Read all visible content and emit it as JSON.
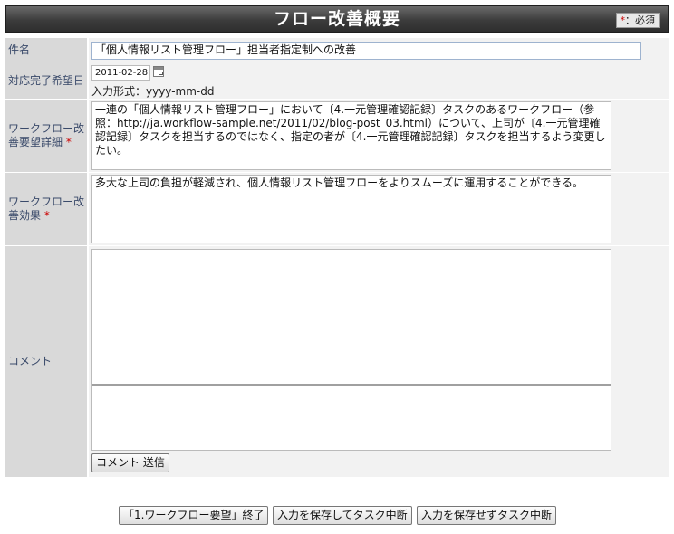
{
  "header": {
    "title": "フロー改善概要",
    "required_legend_mark": "*",
    "required_legend_text": "：必須"
  },
  "fields": {
    "subject": {
      "label": "件名",
      "value": "「個人情報リスト管理フロー」担当者指定制への改善"
    },
    "due_date": {
      "label": "対応完了希望日",
      "value": "2011-02-28",
      "hint": "入力形式：yyyy-mm-dd",
      "icon": "calendar-icon"
    },
    "detail": {
      "label": "ワークフロー改善要望詳細",
      "required_mark": "*",
      "value": "一連の「個人情報リスト管理フロー」において〔4.一元管理確認記録〕タスクのあるワークフロー（参照：http://ja.workflow-sample.net/2011/02/blog-post_03.html）について、上司が〔4.一元管理確認記録〕タスクを担当するのではなく、指定の者が〔4.一元管理確認記録〕タスクを担当するよう変更したい。"
    },
    "effect": {
      "label": "ワークフロー改善効果",
      "required_mark": "*",
      "value": "多大な上司の負担が軽減され、個人情報リスト管理フローをよりスムーズに運用することができる。"
    },
    "comment": {
      "label": "コメント",
      "value": "",
      "send_label": "コメント 送信"
    }
  },
  "actions": {
    "finish_label": "「1.ワークフロー要望」終了",
    "save_suspend_label": "入力を保存してタスク中断",
    "nosave_suspend_label": "入力を保存せずタスク中断"
  }
}
